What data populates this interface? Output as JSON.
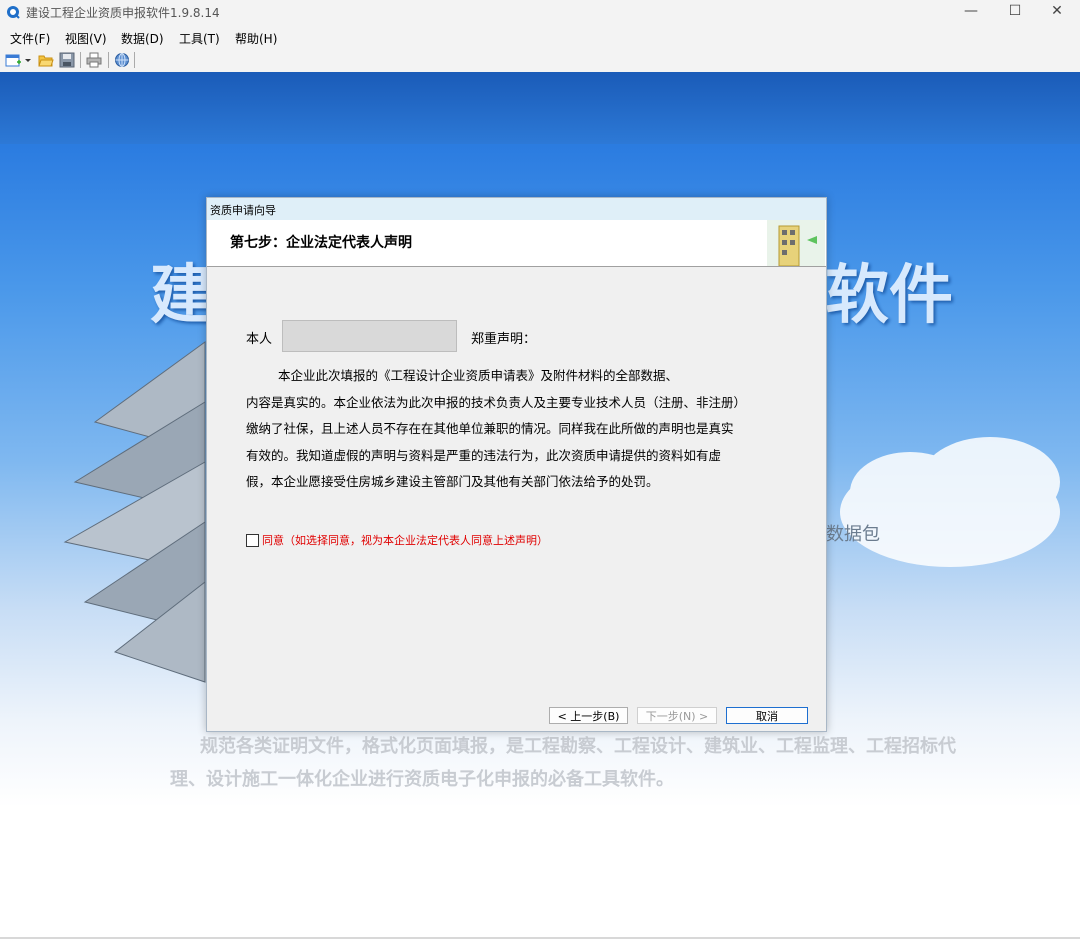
{
  "window": {
    "title": "建设工程企业资质申报软件1.9.8.14",
    "min_label": "—",
    "max_label": "☐",
    "close_label": "✕"
  },
  "menu": {
    "items": [
      {
        "label": "文件(F)"
      },
      {
        "label": "视图(V)"
      },
      {
        "label": "数据(D)"
      },
      {
        "label": "工具(T)"
      },
      {
        "label": "帮助(H)"
      }
    ]
  },
  "toolbar": {
    "icons": [
      "new-icon",
      "dropdown-icon",
      "open-folder-icon",
      "save-icon",
      "print-icon",
      "globe-icon"
    ]
  },
  "background": {
    "title_left": "建",
    "title_right": "软件",
    "data_package_text": "数据包",
    "description": "规范各类证明文件，格式化页面填报，是工程勘察、工程设计、建筑业、工程监理、工程招标代理、设计施工一体化企业进行资质电子化申报的必备工具软件。"
  },
  "dialog": {
    "title": "资质申请向导",
    "step_title": "第七步：企业法定代表人声明",
    "label_me": "本人",
    "name_value": "",
    "label_declare": "郑重声明：",
    "statement": [
      "本企业此次填报的《工程设计企业资质申请表》及附件材料的全部数据、",
      "内容是真实的。本企业依法为此次申报的技术负责人及主要专业技术人员（注册、非注册）",
      "缴纳了社保，且上述人员不存在在其他单位兼职的情况。同样我在此所做的声明也是真实",
      "有效的。我知道虚假的声明与资料是严重的违法行为，此次资质申请提供的资料如有虚",
      "假，本企业愿接受住房城乡建设主管部门及其他有关部门依法给予的处罚。"
    ],
    "agree_checked": false,
    "agree_label": "同意（如选择同意，视为本企业法定代表人同意上述声明）",
    "buttons": {
      "prev": "< 上一步(B)",
      "next": "下一步(N) >",
      "cancel": "取消"
    }
  }
}
